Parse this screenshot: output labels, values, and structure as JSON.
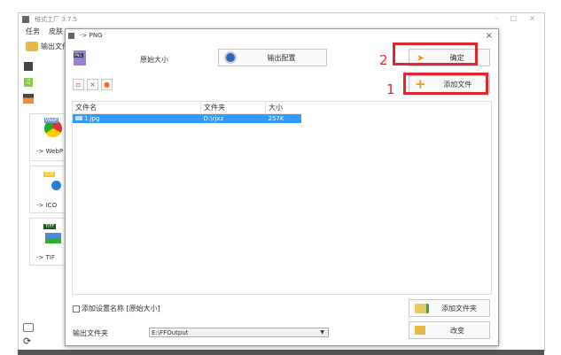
{
  "app": {
    "title": "格式工厂 3.7.5",
    "menu": [
      "任务",
      "皮肤"
    ],
    "output_folder_label": "输出文件",
    "window_controls": [
      "-",
      "□",
      "×"
    ]
  },
  "sidebar": {
    "items": [
      {
        "label": "-> WebP",
        "badge": "WebP"
      },
      {
        "label": "-> ICO",
        "badge": "ICO"
      },
      {
        "label": "-> TIF",
        "badge": "TIFF"
      }
    ]
  },
  "dialog": {
    "title": "-> PNG",
    "close": "×",
    "icon_badge": "PNG",
    "preset": "原始大小",
    "output_config": "输出配置",
    "ok": "确定",
    "add_file": "添加文件",
    "table": {
      "headers": [
        "文件名",
        "文件夹",
        "大小"
      ],
      "rows": [
        {
          "name": "1.jpg",
          "folder": "D:\\rjxz",
          "size": "257K"
        }
      ]
    },
    "add_setting_name": "添加设置名称 [原始大小]",
    "add_folder": "添加文件夹",
    "output_folder_label": "输出文件夹",
    "output_folder_value": "E:\\FFOutput",
    "change": "改变"
  },
  "annotations": [
    "1",
    "2"
  ],
  "colors": {
    "selection": "#3399ff",
    "annotation": "#e3262d"
  }
}
